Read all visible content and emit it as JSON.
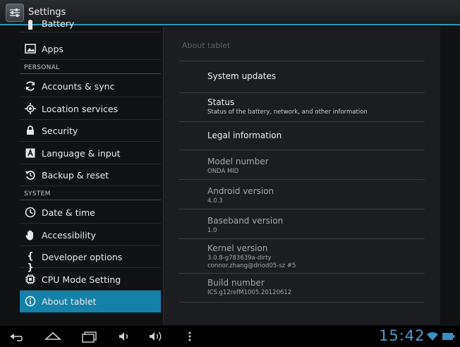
{
  "app": {
    "title": "Settings"
  },
  "sidebar": {
    "items": [
      {
        "label": "Battery",
        "icon": "battery-icon"
      },
      {
        "label": "Apps",
        "icon": "apps-icon"
      },
      {
        "label": "Accounts & sync",
        "icon": "sync-icon"
      },
      {
        "label": "Location services",
        "icon": "location-icon"
      },
      {
        "label": "Security",
        "icon": "lock-icon"
      },
      {
        "label": "Language & input",
        "icon": "language-icon"
      },
      {
        "label": "Backup & reset",
        "icon": "backup-icon"
      },
      {
        "label": "Date & time",
        "icon": "clock-icon"
      },
      {
        "label": "Accessibility",
        "icon": "hand-icon"
      },
      {
        "label": "Developer options",
        "icon": "braces-icon"
      },
      {
        "label": "CPU Mode Setting",
        "icon": "chip-icon"
      },
      {
        "label": "About tablet",
        "icon": "info-icon",
        "selected": true
      }
    ],
    "headers": {
      "personal": "PERSONAL",
      "system": "SYSTEM"
    }
  },
  "detail": {
    "title": "About tablet",
    "system_updates": "System updates",
    "status_title": "Status",
    "status_sub": "Status of the battery, network, and other information",
    "legal": "Legal information",
    "model_title": "Model number",
    "model_value": "ONDA MID",
    "android_title": "Android version",
    "android_value": "4.0.3",
    "baseband_title": "Baseband version",
    "baseband_value": "1.0",
    "kernel_title": "Kernel version",
    "kernel_value1": "3.0.8-g783639a-dirty",
    "kernel_value2": "connor.zhang@driod05-sz #5",
    "build_title": "Build number",
    "build_value": "ICS.g12refM1005.20120612"
  },
  "navbar": {
    "time": "15:42"
  },
  "colors": {
    "accent": "#1481a8",
    "clock": "#4a9ec8",
    "titlebar_line": "#2f9ab8"
  }
}
